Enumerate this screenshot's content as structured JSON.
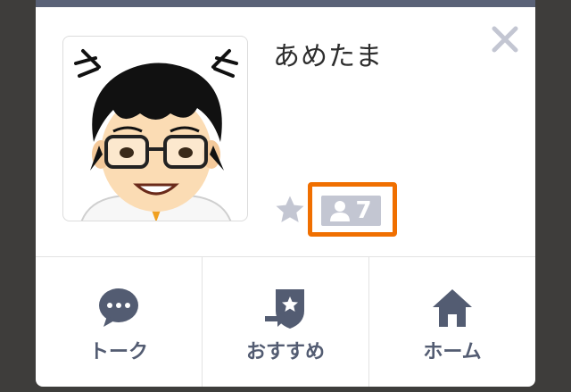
{
  "profile": {
    "name": "あめたま",
    "friend_count": "7"
  },
  "icons": {
    "close": "close-icon",
    "favorite": "star-icon",
    "friends": "person-icon"
  },
  "actions": [
    {
      "label": "トーク",
      "icon": "chat-bubble-icon"
    },
    {
      "label": "おすすめ",
      "icon": "recommend-share-icon"
    },
    {
      "label": "ホーム",
      "icon": "home-icon"
    }
  ],
  "colors": {
    "accent_highlight": "#f06f00",
    "badge_bg": "#c3c6d2",
    "icon_navy": "#535c72",
    "star_gray": "#c3c6d2",
    "backdrop": "#3e3d3b"
  }
}
